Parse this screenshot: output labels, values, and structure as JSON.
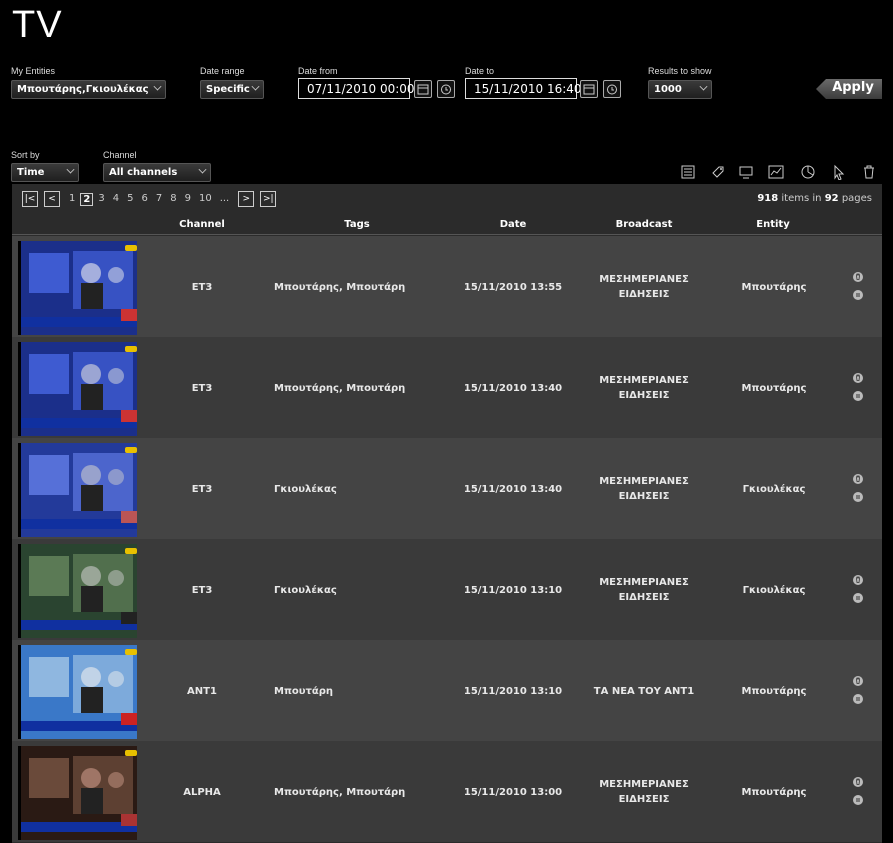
{
  "page": {
    "title": "TV"
  },
  "filters": {
    "entities": {
      "label": "My Entities",
      "value": "Μπουτάρης,Γκιουλέκας"
    },
    "date_range": {
      "label": "Date range",
      "value": "Specific"
    },
    "date_from": {
      "label": "Date from",
      "value": "07/11/2010 00:00"
    },
    "date_to": {
      "label": "Date to",
      "value": "15/11/2010 16:40"
    },
    "results": {
      "label": "Results to show",
      "value": "1000"
    },
    "apply_label": "Apply",
    "sort_by": {
      "label": "Sort by",
      "value": "Time"
    },
    "channel": {
      "label": "Channel",
      "value": "All channels"
    }
  },
  "pager": {
    "pages": [
      "1",
      "2",
      "3",
      "4",
      "5",
      "6",
      "7",
      "8",
      "9",
      "10",
      "..."
    ],
    "current": "2",
    "items": "918",
    "items_text": "items in",
    "pages_count": "92",
    "pages_text": "pages"
  },
  "table": {
    "headers": {
      "channel": "Channel",
      "tags": "Tags",
      "date": "Date",
      "broadcast": "Broadcast",
      "entity": "Entity"
    },
    "rows": [
      {
        "channel": "ET3",
        "tags": "Μπουτάρης, Μπουτάρη",
        "date": "15/11/2010 13:55",
        "broadcast_1": "ΜΕΣΗΜΕΡΙΑΝΕΣ",
        "broadcast_2": "ΕΙΔΗΣΕΙΣ",
        "entity": "Μπουτάρης"
      },
      {
        "channel": "ET3",
        "tags": "Μπουτάρης, Μπουτάρη",
        "date": "15/11/2010 13:40",
        "broadcast_1": "ΜΕΣΗΜΕΡΙΑΝΕΣ",
        "broadcast_2": "ΕΙΔΗΣΕΙΣ",
        "entity": "Μπουτάρης"
      },
      {
        "channel": "ET3",
        "tags": "Γκιουλέκας",
        "date": "15/11/2010 13:40",
        "broadcast_1": "ΜΕΣΗΜΕΡΙΑΝΕΣ",
        "broadcast_2": "ΕΙΔΗΣΕΙΣ",
        "entity": "Γκιουλέκας"
      },
      {
        "channel": "ET3",
        "tags": "Γκιουλέκας",
        "date": "15/11/2010 13:10",
        "broadcast_1": "ΜΕΣΗΜΕΡΙΑΝΕΣ",
        "broadcast_2": "ΕΙΔΗΣΕΙΣ",
        "entity": "Γκιουλέκας"
      },
      {
        "channel": "ANT1",
        "tags": "Μπουτάρη",
        "date": "15/11/2010 13:10",
        "broadcast_1": "ΤΑ ΝΕΑ ΤΟΥ ΑΝΤ1",
        "broadcast_2": "",
        "entity": "Μπουτάρης"
      },
      {
        "channel": "ALPHA",
        "tags": "Μπουτάρης, Μπουτάρη",
        "date": "15/11/2010 13:00",
        "broadcast_1": "ΜΕΣΗΜΕΡΙΑΝΕΣ",
        "broadcast_2": "ΕΙΔΗΣΕΙΣ",
        "entity": "Μπουτάρης"
      }
    ]
  }
}
